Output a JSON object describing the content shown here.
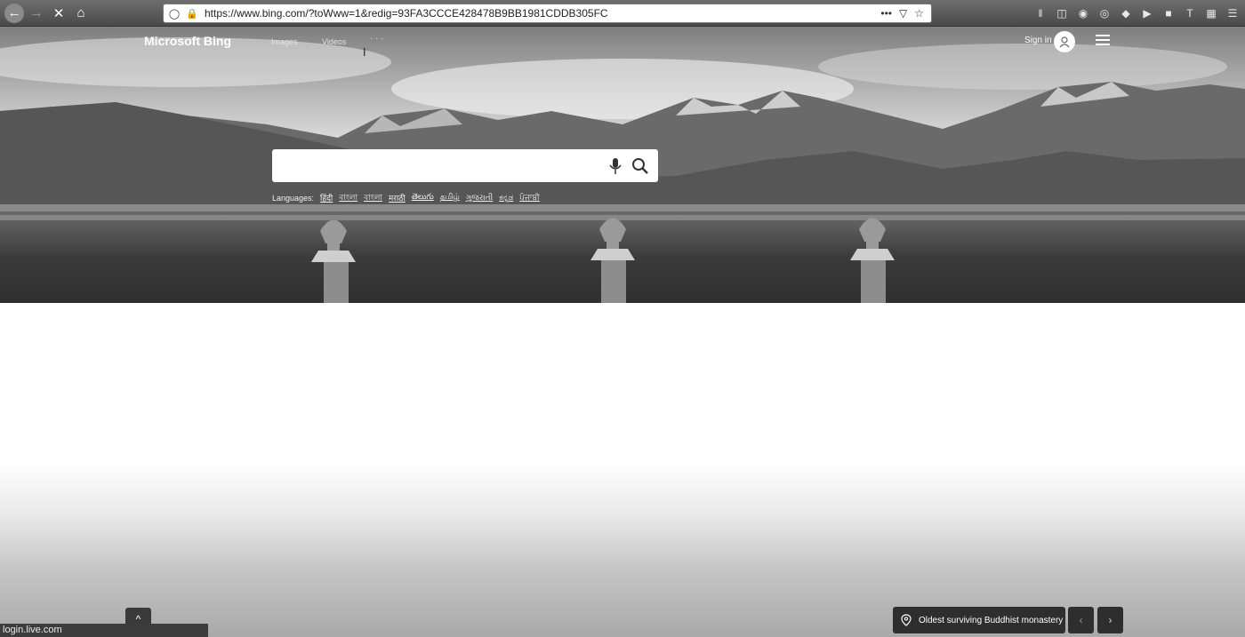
{
  "browser": {
    "url": "https://www.bing.com/?toWww=1&redig=93FA3CCCE428478B9BB1981CDDB305FC",
    "back_icon": "arrow-left-icon",
    "forward_icon": "arrow-right-icon",
    "stop_icon": "close-icon",
    "home_icon": "home-icon",
    "more_label": "•••",
    "status_text": "login.live.com"
  },
  "header": {
    "brand": "Microsoft Bing",
    "nav": [
      "Images",
      "Videos",
      "· · ·"
    ],
    "signin_label": "Sign in"
  },
  "search": {
    "placeholder": "",
    "value": ""
  },
  "languages": {
    "label": "Languages:",
    "items": [
      "हिंदी",
      "বাংলা",
      "বাংলা",
      "मराठी",
      "తెలుగు",
      "தமிழ்",
      "ગુજરાતી",
      "ಕನ್ನಡ",
      "ਪੰਜਾਬੀ"
    ]
  },
  "image_info": {
    "caption": "Oldest surviving Buddhist monastery",
    "prev_label": "‹",
    "next_label": "›"
  },
  "scroll_top_label": "^"
}
